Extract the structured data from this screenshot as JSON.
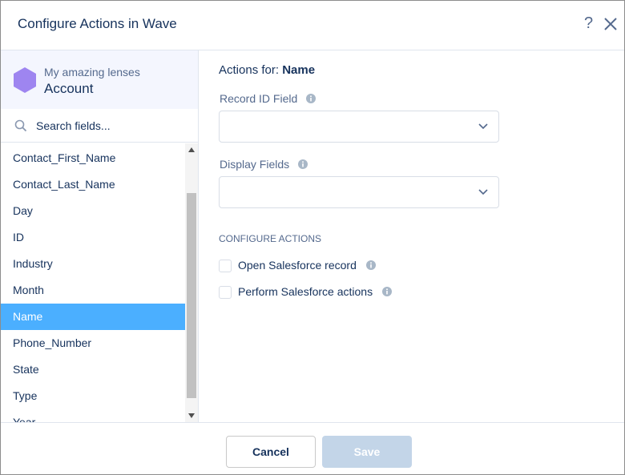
{
  "dialog": {
    "title": "Configure Actions in Wave",
    "help_label": "?",
    "close_icon": "close-icon"
  },
  "lens": {
    "name": "My amazing lenses",
    "dataset": "Account",
    "icon": "hexagon-icon",
    "icon_color": "#9e85f0"
  },
  "search": {
    "placeholder": "Search fields...",
    "value": ""
  },
  "fields": [
    {
      "label": "Contact_First_Name",
      "selected": false
    },
    {
      "label": "Contact_Last_Name",
      "selected": false
    },
    {
      "label": "Day",
      "selected": false
    },
    {
      "label": "ID",
      "selected": false
    },
    {
      "label": "Industry",
      "selected": false
    },
    {
      "label": "Month",
      "selected": false
    },
    {
      "label": "Name",
      "selected": true
    },
    {
      "label": "Phone_Number",
      "selected": false
    },
    {
      "label": "State",
      "selected": false
    },
    {
      "label": "Type",
      "selected": false
    },
    {
      "label": "Year",
      "selected": false
    }
  ],
  "main": {
    "actions_for_prefix": "Actions for: ",
    "actions_for_field": "Name",
    "record_id_label": "Record ID Field",
    "record_id_value": "",
    "display_fields_label": "Display Fields",
    "display_fields_value": "",
    "section_title": "CONFIGURE ACTIONS",
    "open_record_label": "Open Salesforce record",
    "open_record_checked": false,
    "perform_actions_label": "Perform Salesforce actions",
    "perform_actions_checked": false
  },
  "footer": {
    "cancel_label": "Cancel",
    "save_label": "Save"
  },
  "colors": {
    "selected_row": "#4bafff",
    "save_disabled": "#c3d5e8",
    "text": "#16325c",
    "muted": "#54698d"
  }
}
